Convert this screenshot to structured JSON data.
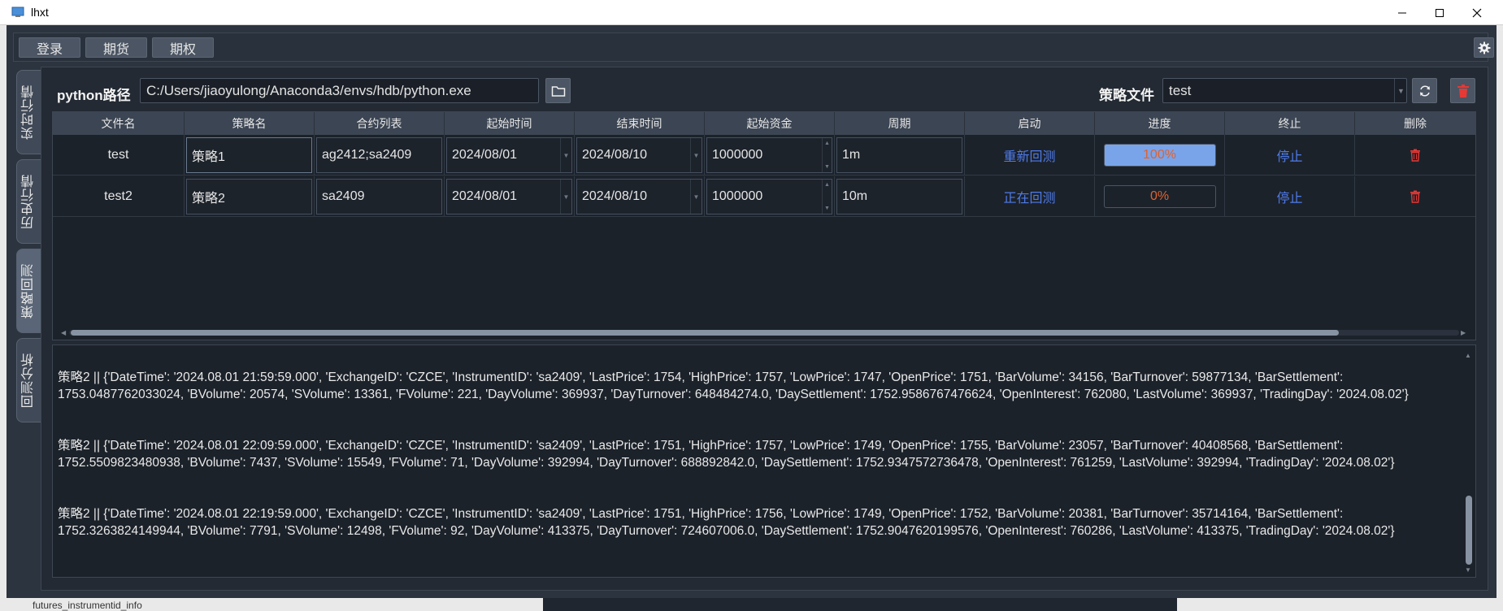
{
  "window": {
    "title": "lhxt"
  },
  "menubar": {
    "items": [
      "登录",
      "期货",
      "期权"
    ]
  },
  "tabs": [
    "实时行情",
    "历史行情",
    "策略回测",
    "回测分析"
  ],
  "active_tab": 2,
  "form": {
    "python_label": "python路径",
    "python_path": "C:/Users/jiaoyulong/Anaconda3/envs/hdb/python.exe",
    "strategy_label": "策略文件",
    "strategy_file": "test"
  },
  "table": {
    "headers": [
      "文件名",
      "策略名",
      "合约列表",
      "起始时间",
      "结束时间",
      "起始资金",
      "周期",
      "启动",
      "进度",
      "终止",
      "删除"
    ],
    "rows": [
      {
        "file": "test",
        "strategy": "策略1",
        "contracts": "ag2412;sa2409",
        "start": "2024/08/01",
        "end": "2024/08/10",
        "capital": "1000000",
        "period": "1m",
        "action": "重新回测",
        "progress_text": "100%",
        "progress": 1.0,
        "stop": "停止"
      },
      {
        "file": "test2",
        "strategy": "策略2",
        "contracts": "sa2409",
        "start": "2024/08/01",
        "end": "2024/08/10",
        "capital": "1000000",
        "period": "10m",
        "action": "正在回测",
        "progress_text": "0%",
        "progress": 0.0,
        "stop": "停止"
      }
    ]
  },
  "log": [
    "策略2 || {'DateTime': '2024.08.01 21:59:59.000', 'ExchangeID': 'CZCE', 'InstrumentID': 'sa2409', 'LastPrice': 1754, 'HighPrice': 1757, 'LowPrice': 1747, 'OpenPrice': 1751, 'BarVolume': 34156, 'BarTurnover': 59877134, 'BarSettlement': 1753.0487762033024, 'BVolume': 20574, 'SVolume': 13361, 'FVolume': 221, 'DayVolume': 369937, 'DayTurnover': 648484274.0, 'DaySettlement': 1752.9586767476624, 'OpenInterest': 762080, 'LastVolume': 369937, 'TradingDay': '2024.08.02'}",
    "策略2 || {'DateTime': '2024.08.01 22:09:59.000', 'ExchangeID': 'CZCE', 'InstrumentID': 'sa2409', 'LastPrice': 1751, 'HighPrice': 1757, 'LowPrice': 1749, 'OpenPrice': 1755, 'BarVolume': 23057, 'BarTurnover': 40408568, 'BarSettlement': 1752.5509823480938, 'BVolume': 7437, 'SVolume': 15549, 'FVolume': 71, 'DayVolume': 392994, 'DayTurnover': 688892842.0, 'DaySettlement': 1752.9347572736478, 'OpenInterest': 761259, 'LastVolume': 392994, 'TradingDay': '2024.08.02'}",
    "策略2 || {'DateTime': '2024.08.01 22:19:59.000', 'ExchangeID': 'CZCE', 'InstrumentID': 'sa2409', 'LastPrice': 1751, 'HighPrice': 1756, 'LowPrice': 1749, 'OpenPrice': 1752, 'BarVolume': 20381, 'BarTurnover': 35714164, 'BarSettlement': 1752.3263824149944, 'BVolume': 7791, 'SVolume': 12498, 'FVolume': 92, 'DayVolume': 413375, 'DayTurnover': 724607006.0, 'DaySettlement': 1752.9047620199576, 'OpenInterest': 760286, 'LastVolume': 413375, 'TradingDay': '2024.08.02'}"
  ],
  "background_text": "futures_instrumentid_info",
  "colors": {
    "link": "#4f7be8",
    "progress_text": "#e0622f",
    "progress_fill": "#7aa4ea",
    "delete": "#e53935"
  }
}
